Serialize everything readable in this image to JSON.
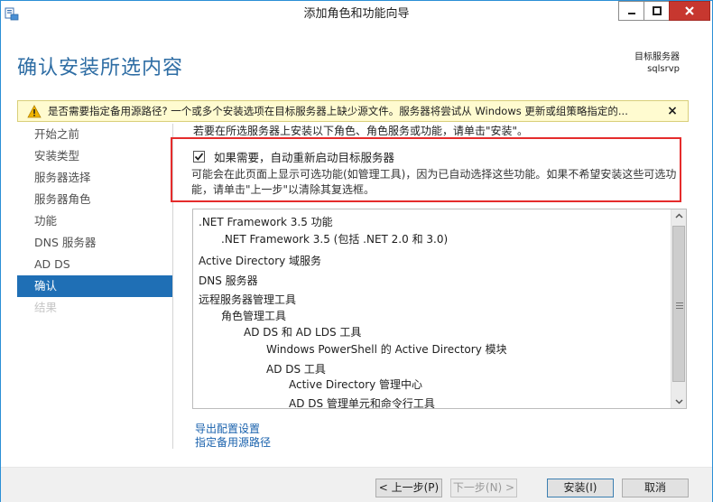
{
  "window": {
    "title": "添加角色和功能向导"
  },
  "header": {
    "page_title": "确认安装所选内容",
    "target_label": "目标服务器",
    "target_name": "sqlsrvp"
  },
  "warning": {
    "text": "是否需要指定备用源路径? 一个或多个安装选项在目标服务器上缺少源文件。服务器将尝试从 Windows 更新或组策略指定的...",
    "close_glyph": "×"
  },
  "nav": {
    "items": [
      {
        "label": "开始之前",
        "state": "normal"
      },
      {
        "label": "安装类型",
        "state": "normal"
      },
      {
        "label": "服务器选择",
        "state": "normal"
      },
      {
        "label": "服务器角色",
        "state": "normal"
      },
      {
        "label": "功能",
        "state": "normal"
      },
      {
        "label": "DNS 服务器",
        "state": "normal"
      },
      {
        "label": "AD DS",
        "state": "normal"
      },
      {
        "label": "确认",
        "state": "active"
      },
      {
        "label": "结果",
        "state": "disabled"
      }
    ]
  },
  "content": {
    "intro": "若要在所选服务器上安装以下角色、角色服务或功能，请单击\"安装\"。",
    "restart_checkbox": {
      "label": "如果需要，自动重新启动目标服务器",
      "checked": true
    },
    "restart_note": "可能会在此页面上显示可选功能(如管理工具)，因为已自动选择这些功能。如果不希望安装这些可选功能，请单击\"上一步\"以清除其复选框。",
    "features": [
      {
        "label": ".NET Framework 3.5 功能",
        "level": 0
      },
      {
        "label": ".NET Framework 3.5 (包括 .NET 2.0 和 3.0)",
        "level": 1
      },
      {
        "label": "Active Directory 域服务",
        "level": 0
      },
      {
        "label": "DNS 服务器",
        "level": 0
      },
      {
        "label": "远程服务器管理工具",
        "level": 0
      },
      {
        "label": "角色管理工具",
        "level": 1
      },
      {
        "label": "AD DS 和 AD LDS 工具",
        "level": 2
      },
      {
        "label": "Windows PowerShell 的 Active Directory 模块",
        "level": 3
      },
      {
        "label": "AD DS 工具",
        "level": 3
      },
      {
        "label": "Active Directory 管理中心",
        "level": 4
      },
      {
        "label": "AD DS 管理单元和命令行工具",
        "level": 4
      }
    ],
    "links": {
      "export": "导出配置设置",
      "alt_source": "指定备用源路径"
    }
  },
  "footer": {
    "prev": "< 上一步(P)",
    "next": "下一步(N) >",
    "install": "安装(I)",
    "cancel": "取消"
  },
  "colors": {
    "accent": "#1f6fb5",
    "title": "#2e6da4",
    "highlight": "#e52c2c",
    "warning_bg": "#fffbd0",
    "close_red": "#c7372f"
  }
}
